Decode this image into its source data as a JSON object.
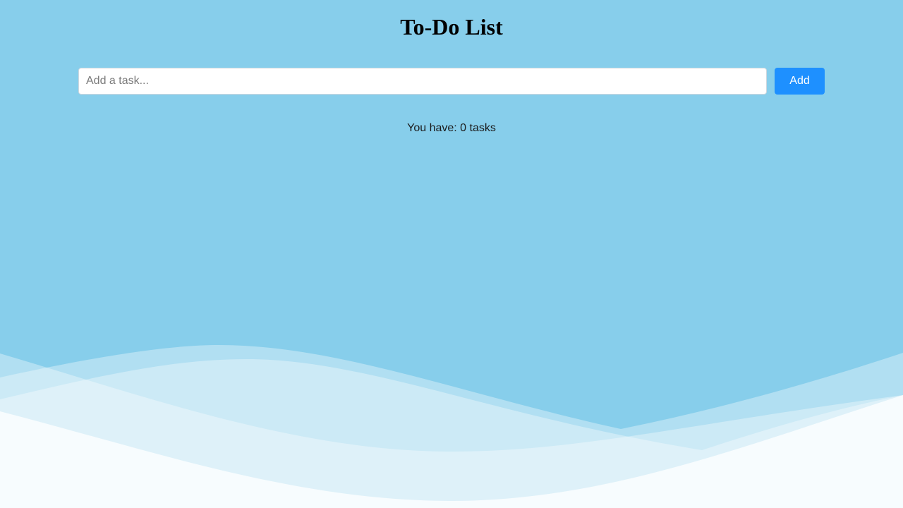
{
  "page": {
    "title": "To-Do List"
  },
  "task_input": {
    "placeholder": "Add a task...",
    "value": ""
  },
  "add_button": {
    "label": "Add"
  },
  "task_count": {
    "text": "You have: 0 tasks"
  },
  "tasks": [],
  "colors": {
    "background": "#87ceeb",
    "accent": "#1e90ff",
    "input_background": "#ffffff",
    "wave_fill": "#ffffff"
  }
}
